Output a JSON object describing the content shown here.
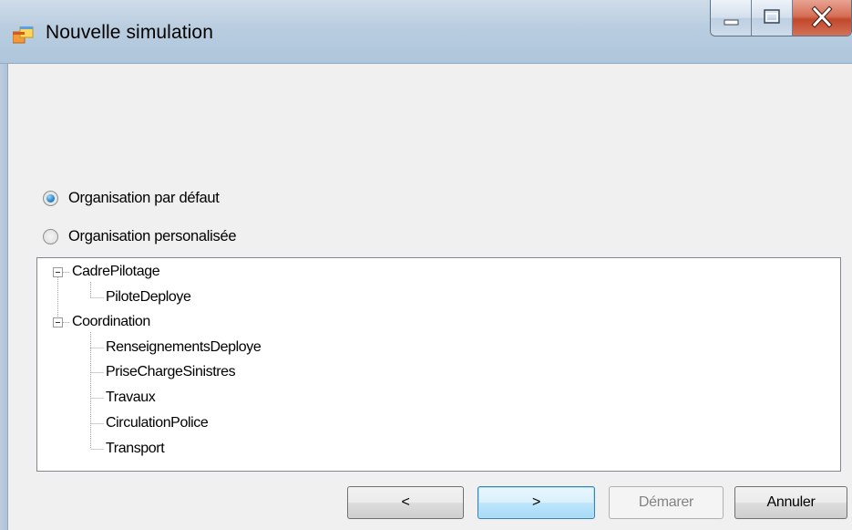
{
  "window": {
    "title": "Nouvelle simulation",
    "controls": {
      "minimize_icon": "minimize-icon",
      "maximize_icon": "maximize-icon",
      "close_icon": "close-icon"
    }
  },
  "options": {
    "default_label": "Organisation par défaut",
    "custom_label": "Organisation personalisée",
    "selected": "default"
  },
  "tree": {
    "nodes": [
      {
        "label": "CadrePilotage",
        "level": 0,
        "expanded": true
      },
      {
        "label": "PiloteDeploye",
        "level": 1
      },
      {
        "label": "Coordination",
        "level": 0,
        "expanded": true
      },
      {
        "label": "RenseignementsDeploye",
        "level": 1
      },
      {
        "label": "PriseChargeSinistres",
        "level": 1
      },
      {
        "label": "Travaux",
        "level": 1
      },
      {
        "label": "CirculationPolice",
        "level": 1
      },
      {
        "label": "Transport",
        "level": 1
      }
    ]
  },
  "buttons": {
    "back_label": "<",
    "next_label": ">",
    "start_label": "Démarer",
    "cancel_label": "Annuler"
  }
}
